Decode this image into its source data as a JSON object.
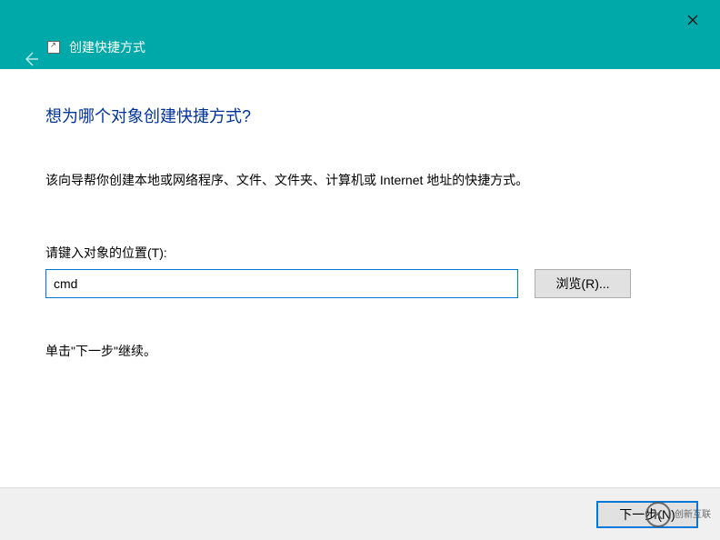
{
  "window": {
    "title": "创建快捷方式"
  },
  "main": {
    "heading": "想为哪个对象创建快捷方式?",
    "description": "该向导帮你创建本地或网络程序、文件、文件夹、计算机或 Internet 地址的快捷方式。",
    "input_label": "请键入对象的位置(T):",
    "input_value": "cmd",
    "browse_label": "浏览(R)...",
    "continue_text": "单击\"下一步\"继续。"
  },
  "footer": {
    "next_label": "下一步(N)"
  },
  "watermark": {
    "logo_char": "K",
    "brand": "创新互联"
  }
}
